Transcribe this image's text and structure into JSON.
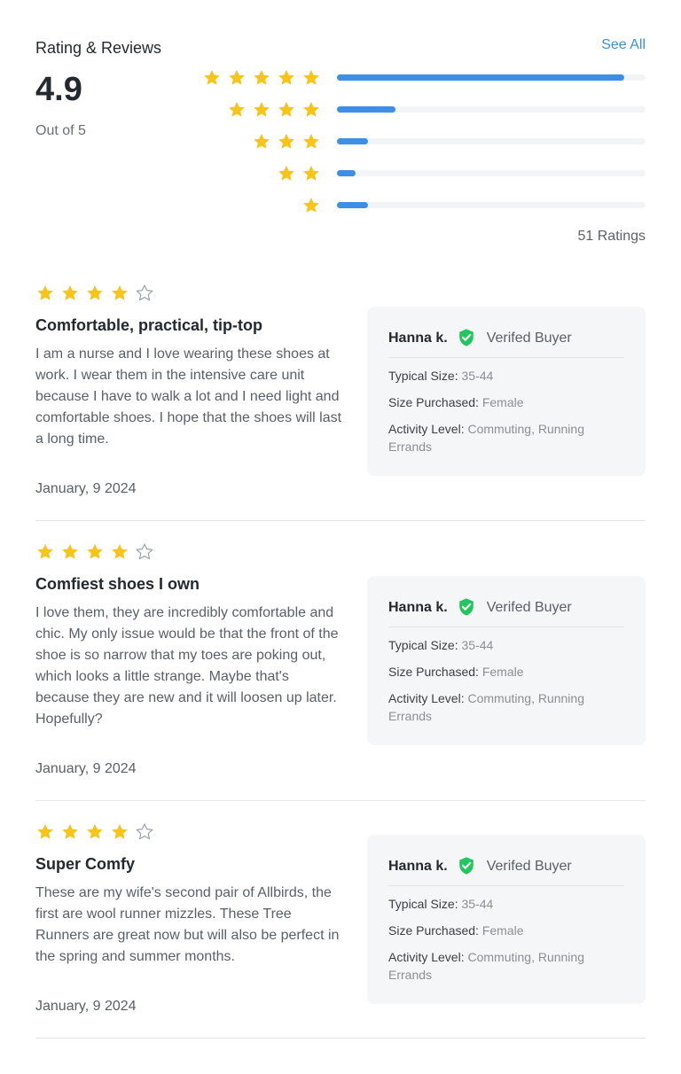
{
  "summary": {
    "title": "Rating & Reviews",
    "see_all": "See All",
    "average": "4.9",
    "out_of": "Out of 5",
    "ratings_count": "51 Ratings",
    "distribution": [
      {
        "stars": 5,
        "fraction": 0.93
      },
      {
        "stars": 4,
        "fraction": 0.19
      },
      {
        "stars": 3,
        "fraction": 0.1
      },
      {
        "stars": 2,
        "fraction": 0.06
      },
      {
        "stars": 1,
        "fraction": 0.1
      }
    ]
  },
  "colors": {
    "star": "#f7c418",
    "bar_fill": "#3b8fe6",
    "bar_track": "#f3f4f6",
    "link": "#3b8fe0",
    "verified": "#22c55e",
    "card_bg": "#f5f6f8"
  },
  "icons": {
    "star": "star-icon",
    "verified": "verified-check-shield-icon"
  },
  "reviews": [
    {
      "rating": 4,
      "title": "Comfortable, practical, tip-top",
      "body": "I am a nurse and I love wearing these shoes at work. I wear them in the intensive care unit because I have to walk a lot and I need light and comfortable shoes. I hope that the shoes will last a long time.",
      "date": "January, 9 2024",
      "buyer": {
        "name": "Hanna k.",
        "verified_label": "Verifed Buyer",
        "typical_size_label": "Typical Size:",
        "typical_size": "35-44",
        "size_purchased_label": "Size Purchased:",
        "size_purchased": "Female",
        "activity_label": "Activity Level:",
        "activity": "Commuting, Running Errands"
      }
    },
    {
      "rating": 4,
      "title": "Comfiest shoes I own",
      "body": "I love them, they are incredibly comfortable and chic. My only issue would be that the front of the shoe is so narrow that my toes are poking out, which looks a little strange. Maybe that's because they are new and it will loosen up later. Hopefully?",
      "date": "January, 9 2024",
      "buyer": {
        "name": "Hanna k.",
        "verified_label": "Verifed Buyer",
        "typical_size_label": "Typical Size:",
        "typical_size": "35-44",
        "size_purchased_label": "Size Purchased:",
        "size_purchased": "Female",
        "activity_label": "Activity Level:",
        "activity": "Commuting, Running Errands"
      }
    },
    {
      "rating": 4,
      "title": "Super Comfy",
      "body": "These are my wife's second pair of Allbirds, the first are wool runner mizzles. These Tree Runners are great now but will also be perfect in the spring and summer months.",
      "date": "January, 9 2024",
      "buyer": {
        "name": "Hanna k.",
        "verified_label": "Verifed Buyer",
        "typical_size_label": "Typical Size:",
        "typical_size": "35-44",
        "size_purchased_label": "Size Purchased:",
        "size_purchased": "Female",
        "activity_label": "Activity Level:",
        "activity": "Commuting, Running Errands"
      }
    }
  ]
}
